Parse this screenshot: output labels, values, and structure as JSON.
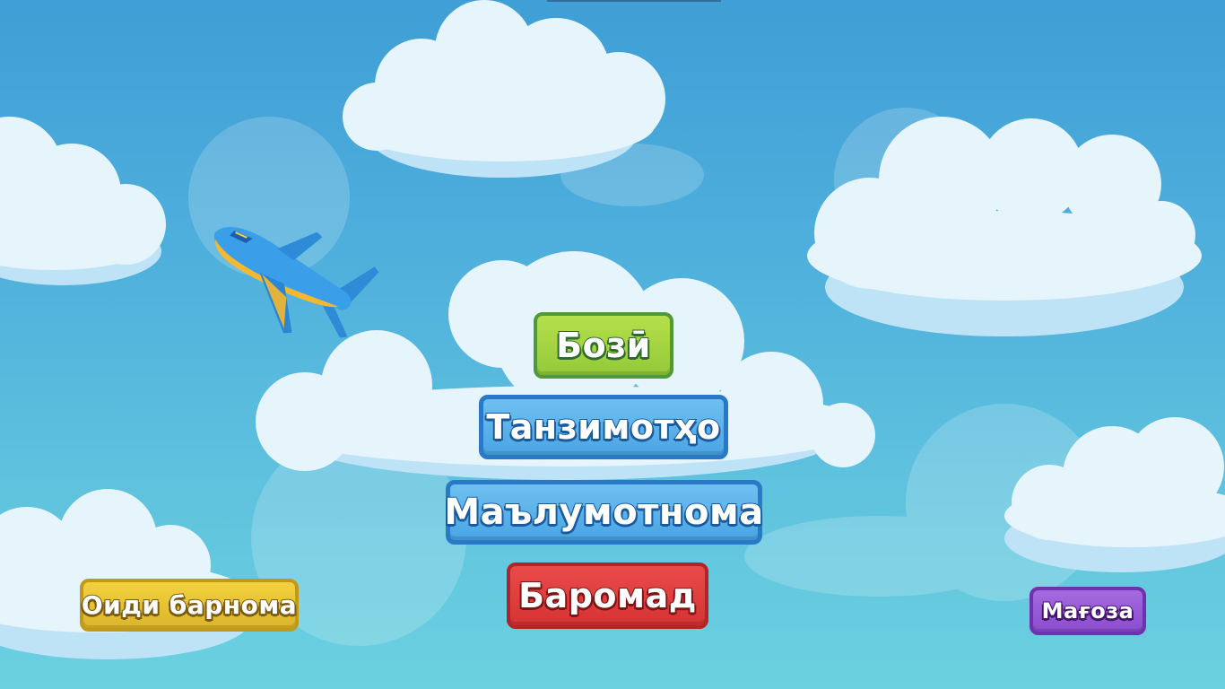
{
  "menu": {
    "play_label": "Бозӣ",
    "settings_label": "Танзимотҳо",
    "info_label": "Маълумотнома",
    "exit_label": "Баромад"
  },
  "footer": {
    "more_apps_label": "Оиди барнома",
    "store_label": "Мағоза"
  },
  "colors": {
    "sky_top": "#3f9fd6",
    "sky_bottom": "#6bd1e0",
    "play_button": "#94c93a",
    "blue_button": "#4aa5e4",
    "exit_button": "#d63434",
    "more_button": "#dcb52a",
    "store_button": "#8a4ccc",
    "airplane_body": "#3a9ee8",
    "airplane_belly": "#f5b82e"
  },
  "icons": {
    "airplane": "airplane-icon"
  }
}
